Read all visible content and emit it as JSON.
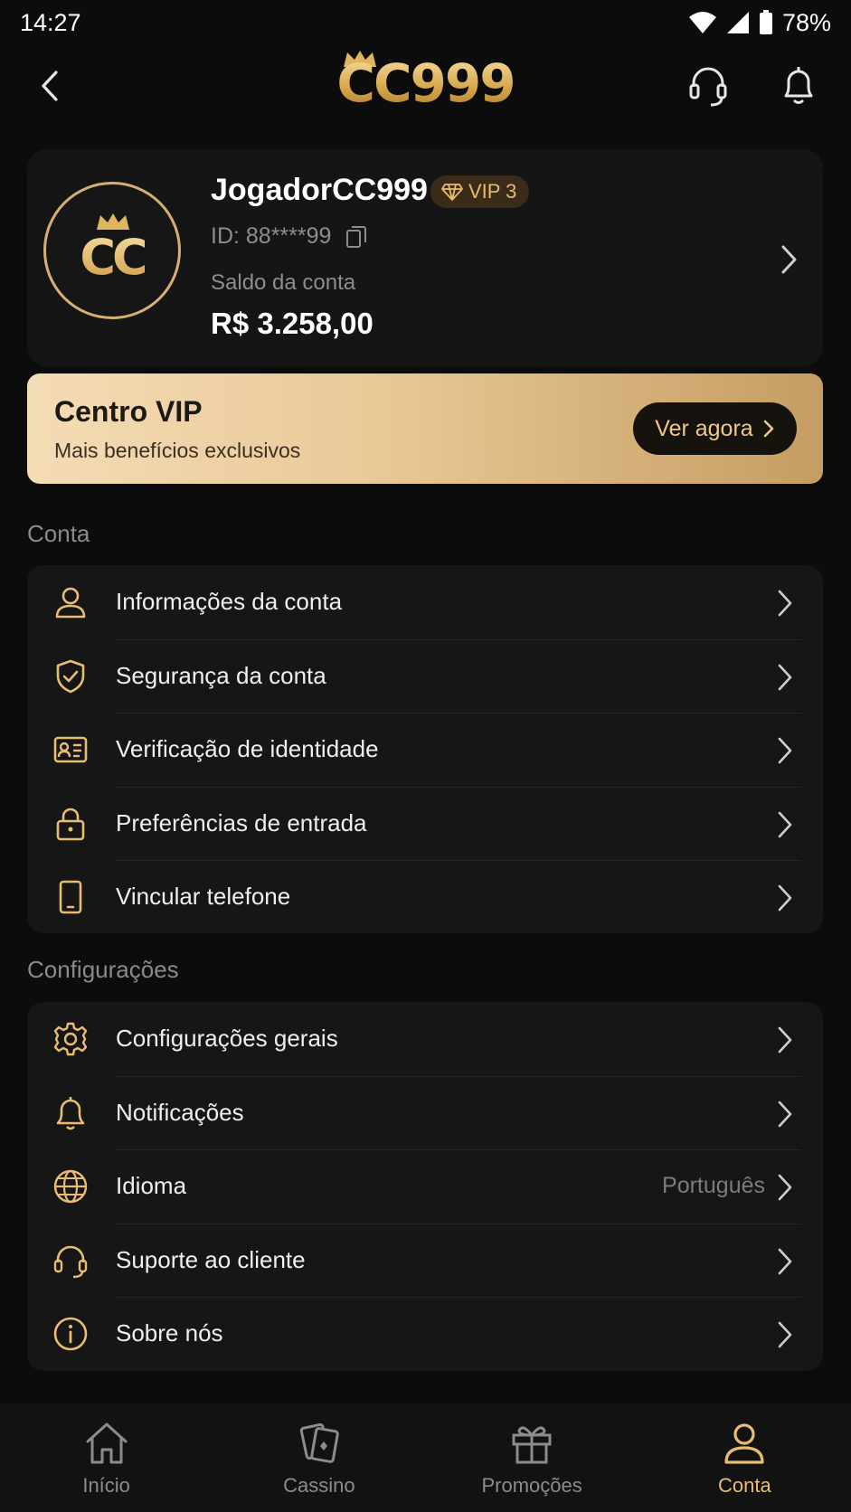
{
  "status_bar": {
    "time": "14:27",
    "battery": "78%"
  },
  "header": {
    "logo": "CC999"
  },
  "profile": {
    "avatar_text": "CC",
    "username": "JogadorCC999",
    "vip_level": "VIP 3",
    "id_text": "ID: 88****99",
    "balance_label": "Saldo da conta",
    "balance_value": "R$ 3.258,00"
  },
  "vip_banner": {
    "title": "Centro VIP",
    "subtitle": "Mais benefícios exclusivos",
    "button_label": "Ver agora"
  },
  "account_section": {
    "title": "Conta",
    "items": [
      {
        "label": "Informações da conta",
        "icon": "user-icon"
      },
      {
        "label": "Segurança da conta",
        "icon": "shield-check-icon"
      },
      {
        "label": "Verificação de identidade",
        "icon": "id-card-icon"
      },
      {
        "label": "Preferências de entrada",
        "icon": "lock-icon"
      },
      {
        "label": "Vincular telefone",
        "icon": "phone-icon"
      }
    ]
  },
  "settings_section": {
    "title": "Configurações",
    "items": [
      {
        "label": "Configurações gerais",
        "icon": "gear-icon"
      },
      {
        "label": "Notificações",
        "icon": "bell-icon"
      },
      {
        "label": "Idioma",
        "icon": "globe-icon",
        "value": "Português"
      },
      {
        "label": "Suporte ao cliente",
        "icon": "headset-icon"
      },
      {
        "label": "Sobre nós",
        "icon": "info-icon"
      }
    ]
  },
  "bottom_nav": {
    "items": [
      {
        "label": "Início",
        "icon": "home-icon"
      },
      {
        "label": "Cassino",
        "icon": "cards-icon"
      },
      {
        "label": "Promoções",
        "icon": "gift-icon"
      },
      {
        "label": "Conta",
        "icon": "user-icon",
        "active": true
      }
    ]
  },
  "colors": {
    "accent": "#e8bd72",
    "background": "#0c0c0c",
    "card": "#161616"
  }
}
